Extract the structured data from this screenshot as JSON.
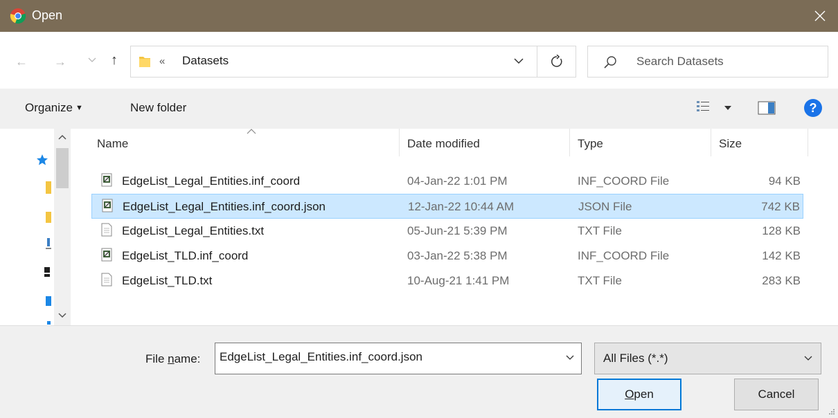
{
  "window": {
    "title": "Open",
    "app_icon": "chrome-icon",
    "close_icon": "close-icon"
  },
  "address_bar": {
    "back_icon": "arrow-left-icon",
    "forward_icon": "arrow-right-icon",
    "recent_icon": "chevron-down-icon",
    "up_icon": "arrow-up-icon",
    "breadcrumb_prefix": "«",
    "path": "Datasets",
    "refresh_icon": "refresh-icon"
  },
  "search": {
    "placeholder": "Search Datasets"
  },
  "toolbar": {
    "organize_label": "Organize",
    "new_folder_label": "New folder",
    "view_icon": "view-list-icon",
    "preview_pane_icon": "preview-pane-icon",
    "help_icon": "help-icon"
  },
  "columns": {
    "name": "Name",
    "date_modified": "Date modified",
    "type": "Type",
    "size": "Size"
  },
  "files": [
    {
      "name": "EdgeList_Legal_Entities.inf_coord",
      "date": "04-Jan-22 1:01 PM",
      "type": "INF_COORD File",
      "size": "94 KB",
      "icon": "data-file-icon",
      "selected": false
    },
    {
      "name": "EdgeList_Legal_Entities.inf_coord.json",
      "date": "12-Jan-22 10:44 AM",
      "type": "JSON File",
      "size": "742 KB",
      "icon": "data-file-icon",
      "selected": true
    },
    {
      "name": "EdgeList_Legal_Entities.txt",
      "date": "05-Jun-21 5:39 PM",
      "type": "TXT File",
      "size": "128 KB",
      "icon": "text-file-icon",
      "selected": false
    },
    {
      "name": "EdgeList_TLD.inf_coord",
      "date": "03-Jan-22 5:38 PM",
      "type": "INF_COORD File",
      "size": "142 KB",
      "icon": "data-file-icon",
      "selected": false
    },
    {
      "name": "EdgeList_TLD.txt",
      "date": "10-Aug-21 1:41 PM",
      "type": "TXT File",
      "size": "283 KB",
      "icon": "text-file-icon",
      "selected": false
    }
  ],
  "footer": {
    "file_name_label_pre": "File ",
    "file_name_label_key": "n",
    "file_name_label_post": "ame:",
    "file_name_value": "EdgeList_Legal_Entities.inf_coord.json",
    "file_type": "All Files (*.*)",
    "open_key": "O",
    "open_rest": "pen",
    "cancel_label": "Cancel"
  },
  "colors": {
    "titlebar": "#7b6c56",
    "selection": "#cce8ff",
    "accent": "#0078d7"
  }
}
